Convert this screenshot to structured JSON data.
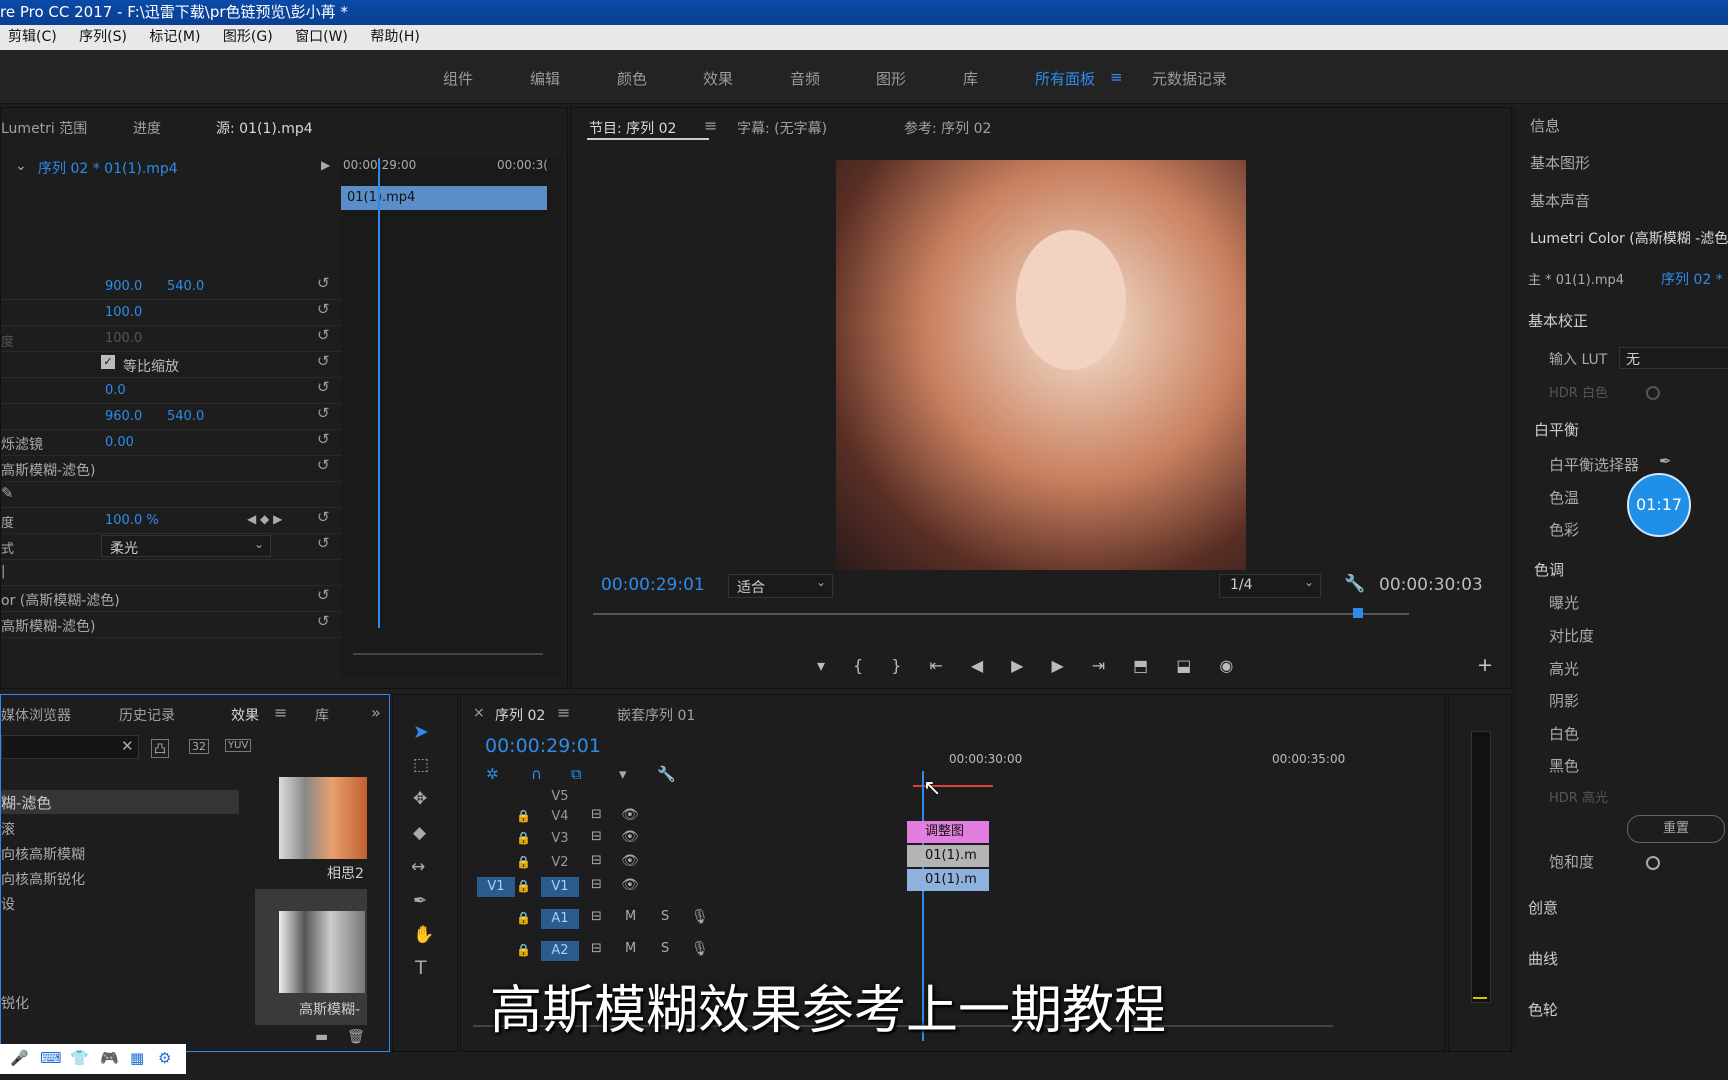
{
  "window": {
    "title": "re Pro CC 2017 - F:\\迅雷下载\\pr色链预览\\彭小苒 *"
  },
  "menu": [
    "剪辑(C)",
    "序列(S)",
    "标记(M)",
    "图形(G)",
    "窗口(W)",
    "帮助(H)"
  ],
  "workspaces": [
    "组件",
    "编辑",
    "颜色",
    "效果",
    "音频",
    "图形",
    "库",
    "所有面板",
    "元数据记录"
  ],
  "effect_controls": {
    "tabs": [
      "Lumetri 范围",
      "进度",
      "源: 01(1).mp4"
    ],
    "sequence_label": "序列 02 * 01(1).mp4",
    "clip_label": "01(1).mp4",
    "timecodes": [
      "00:00:29:00",
      "00:00:3("
    ],
    "rows": [
      {
        "label": "",
        "v1": "900.0",
        "v2": "540.0"
      },
      {
        "label": "",
        "v1": "100.0",
        "v2": ""
      },
      {
        "label": "度",
        "v1": "100.0",
        "v2": ""
      },
      {
        "label": "",
        "v1": "等比缩放",
        "v2": ""
      },
      {
        "label": "",
        "v1": "0.0",
        "v2": ""
      },
      {
        "label": "",
        "v1": "960.0",
        "v2": "540.0"
      },
      {
        "label": "烁滤镜",
        "v1": "0.00",
        "v2": ""
      },
      {
        "label": "高斯模糊-滤色)",
        "v1": "",
        "v2": ""
      },
      {
        "label": "",
        "v1": "",
        "v2": ""
      },
      {
        "label": "度",
        "v1": "100.0 %",
        "v2": ""
      },
      {
        "label": "式",
        "v1": "柔光",
        "v2": ""
      },
      {
        "label": "",
        "v1": "",
        "v2": ""
      },
      {
        "label": "or (高斯模糊-滤色)",
        "v1": "",
        "v2": ""
      },
      {
        "label": "高斯模糊-滤色)",
        "v1": "",
        "v2": ""
      }
    ]
  },
  "program_monitor": {
    "tabs": [
      "节目: 序列 02",
      "字幕: (无字幕)",
      "参考: 序列 02"
    ],
    "timecode_left": "00:00:29:01",
    "fit": "适合",
    "resolution": "1/4",
    "timecode_right": "00:00:30:03"
  },
  "right_panel": {
    "items": [
      "信息",
      "基本图形",
      "基本声音",
      "Lumetri Color (高斯模糊 -滤色 )"
    ],
    "master": "主 * 01(1).mp4",
    "sequence": "序列 02 *",
    "section_basic": "基本校正",
    "input_lut_label": "输入 LUT",
    "input_lut_value": "无",
    "hdr_white": "HDR 白色",
    "white_balance": "白平衡",
    "wb_picker": "白平衡选择器",
    "temp": "色温",
    "tint": "色彩",
    "tone": "色调",
    "tone_items": [
      "曝光",
      "对比度",
      "高光",
      "阴影",
      "白色",
      "黑色",
      "HDR 高光"
    ],
    "reset": "重置",
    "saturation": "饱和度",
    "sections": [
      "创意",
      "曲线",
      "色轮"
    ],
    "timer": "01:17"
  },
  "effects_panel": {
    "tabs": [
      "媒体浏览器",
      "历史记录",
      "效果",
      "库"
    ],
    "list": [
      "糊-滤色",
      "滚",
      "向核高斯模糊",
      "向核高斯锐化",
      "设",
      "锐化"
    ],
    "thumb_labels": [
      "相思2",
      "高斯模糊-"
    ]
  },
  "timeline": {
    "tabs": [
      "序列 02",
      "嵌套序列 01"
    ],
    "timecode": "00:00:29:01",
    "ruler": [
      "00:00:30:00",
      "00:00:35:00"
    ],
    "video_tracks": [
      "V5",
      "V4",
      "V3",
      "V2",
      "V1"
    ],
    "audio_tracks": [
      "A1",
      "A2"
    ],
    "source_patch": "V1",
    "clips": [
      "调整图",
      "01(1).m",
      "01(1).m"
    ],
    "audio_labels": [
      "M",
      "S"
    ]
  },
  "subtitle": "高斯模糊效果参考上一期教程"
}
